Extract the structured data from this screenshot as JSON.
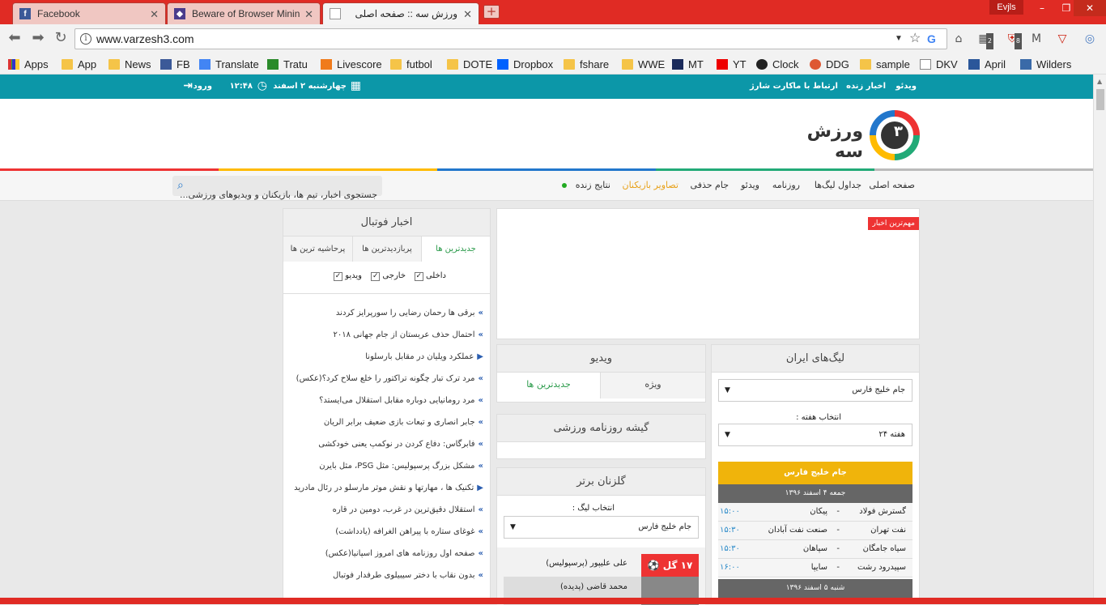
{
  "browser": {
    "tabs": [
      {
        "label": "Facebook",
        "icon": "facebook-icon"
      },
      {
        "label": "Beware of Browser Minin",
        "icon": "page-icon"
      },
      {
        "label": "ورزش سه :: صفحه اصلی",
        "icon": "page-icon"
      }
    ],
    "user_badge": "Evjls",
    "url": "www.varzesh3.com",
    "bookmarks": [
      "Apps",
      "App",
      "News",
      "FB",
      "Translate",
      "Tratu",
      "Livescore",
      "futbol",
      "DOTE",
      "Dropbox",
      "fshare",
      "WWE",
      "MT",
      "YT",
      "Clock",
      "DDG",
      "sample",
      "DKV",
      "April",
      "Wilders"
    ],
    "badges": [
      "2",
      "8"
    ],
    "accent": "#e02b24"
  },
  "site": {
    "topbar": {
      "links": [
        "ویدئو",
        "اخبار زنده",
        "ارتباط با ما",
        "کارت شارژ"
      ],
      "date": "چهارشنبه ۲ اسفند",
      "time": "۱۲:۴۸",
      "login": "ورود",
      "color": "#0c97a8"
    },
    "logo_text": "ورزش سه",
    "logo_mark": "۳",
    "menu": [
      "صفحه اصلی",
      "جداول لیگ‌ها",
      "روزنامه",
      "ویدئو",
      "جام حذفی",
      "تصاویر بازیکنان",
      "نتایج زنده"
    ],
    "search_placeholder": "جستجوی اخبار، تیم ها، بازیکنان و ویدیوهای ورزشی...",
    "top_news_label": "مهم‌ترین اخبار",
    "football_news": {
      "title": "اخبار فوتبال",
      "tabs": [
        "جدیدترین ها",
        "پربازدیدترین ها",
        "پرحاشیه ترین ها"
      ],
      "filters": [
        "داخلی",
        "خارجی",
        "ویدیو"
      ],
      "items": [
        {
          "text": "برقی ها رحمان رضایی را سورپرایز کردند",
          "type": "text"
        },
        {
          "text": "احتمال حذف عربستان از جام جهانی ۲۰۱۸",
          "type": "text"
        },
        {
          "text": "عملکرد ویلیان در مقابل بارسلونا",
          "type": "video"
        },
        {
          "text": "مرد ترک تبار چگونه تراکتور را خلع سلاح کرد؟(عکس)",
          "type": "text"
        },
        {
          "text": "مرد رومانیایی دوباره مقابل استقلال می‌ایستد؟",
          "type": "text"
        },
        {
          "text": "جابر انصاری و تبعات بازی ضعیف برابر الریان",
          "type": "text"
        },
        {
          "text": "فابرگاس: دفاع کردن در نوکمپ یعنی خودکشی",
          "type": "text"
        },
        {
          "text": "مشکل بزرگ پرسپولیس: مثل PSG، مثل بایرن",
          "type": "text"
        },
        {
          "text": "تکنیک ها ، مهارتها و نقش موثر مارسلو در رئال مادرید",
          "type": "video"
        },
        {
          "text": "استقلال دقیق‌ترین در غرب، دومین در قاره",
          "type": "text"
        },
        {
          "text": "غوغای ستاره با پیراهن الغرافه (یادداشت)",
          "type": "text"
        },
        {
          "text": "صفحه اول روزنامه های امروز اسپانیا(عکس)",
          "type": "text"
        },
        {
          "text": "بدون نقاب با دختر سیبیلوی طرفدار فوتبال",
          "type": "text"
        }
      ]
    },
    "video_panel": {
      "title": "ویدیو",
      "tabs": [
        "ویژه",
        "جدیدترین ها"
      ]
    },
    "newspaper_panel": {
      "title": "گیشه روزنامه ورزشی"
    },
    "scorers": {
      "title": "گلزنان برتر",
      "league_label": "انتخاب لیگ :",
      "league_value": "جام خلیج فارس",
      "top": {
        "goals": "۱۷ گل",
        "name": "علی علیپور (پرسپولیس)"
      },
      "second": {
        "name": "محمد قاضی (پدیده)"
      }
    },
    "leagues": {
      "title": "لیگ‌های ایران",
      "league_value": "جام خلیج فارس",
      "week_label": "انتخاب هفته :",
      "week_value": "هفته ۲۴",
      "comp_title": "جام خلیج فارس",
      "day1": "جمعه ۴ اسفند ۱۳۹۶",
      "matches": [
        {
          "home": "گسترش فولاد",
          "away": "پیکان",
          "time": "۱۵:۰۰"
        },
        {
          "home": "نفت تهران",
          "away": "صنعت نفت آبادان",
          "time": "۱۵:۳۰"
        },
        {
          "home": "سیاه جامگان",
          "away": "سپاهان",
          "time": "۱۵:۳۰"
        },
        {
          "home": "سپیدرود رشت",
          "away": "سایپا",
          "time": "۱۶:۰۰"
        }
      ],
      "day2": "شنبه ۵ اسفند ۱۳۹۶"
    }
  }
}
